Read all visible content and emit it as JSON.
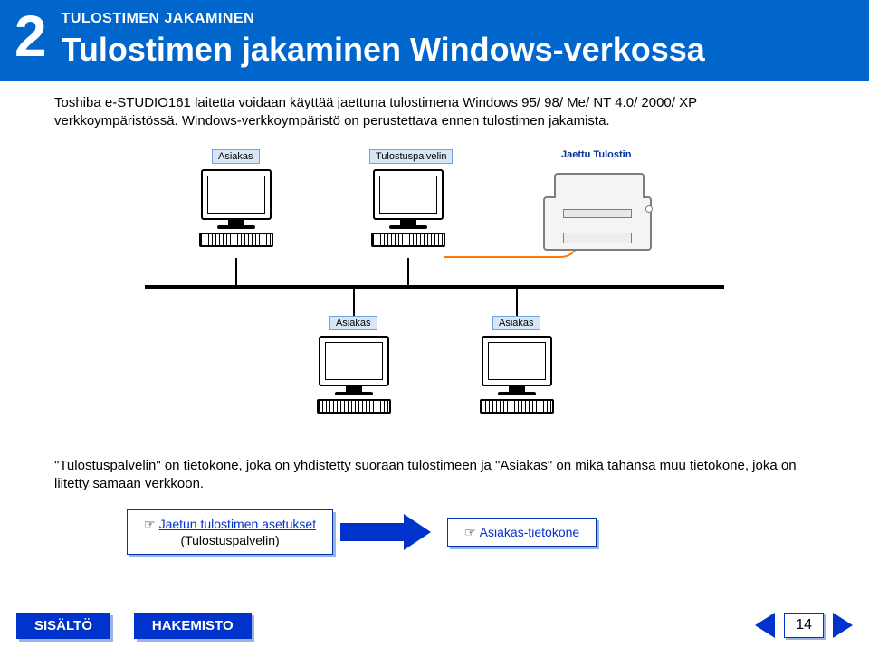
{
  "header": {
    "chapter_num": "2",
    "chapter_label": "TULOSTIMEN JAKAMINEN",
    "title": "Tulostimen jakaminen Windows-verkossa"
  },
  "intro": "Toshiba e-STUDIO161 laitetta voidaan käyttää jaettuna tulostimena Windows 95/ 98/ Me/ NT 4.0/ 2000/ XP verkkoympäristössä. Windows-verkkoympäristö on perustettava ennen tulostimen jakamista.",
  "diagram": {
    "labels": {
      "client_top": "Asiakas",
      "print_server": "Tulostuspalvelin",
      "shared_printer": "Jaettu Tulostin",
      "client_bottom_left": "Asiakas",
      "client_bottom_right": "Asiakas"
    }
  },
  "body2": "\"Tulostuspalvelin\" on tietokone, joka on yhdistetty suoraan tulostimeen ja \"Asiakas\" on mikä tahansa muu tietokone, joka on liitetty samaan verkkoon.",
  "links": {
    "left_hand": "☞",
    "left_link": "Jaetun tulostimen asetukset",
    "left_sub": "(Tulostuspalvelin)",
    "right_hand": "☞",
    "right_link": "Asiakas-tietokone"
  },
  "footer": {
    "contents": "SISÄLTÖ",
    "index": "HAKEMISTO",
    "page": "14"
  }
}
